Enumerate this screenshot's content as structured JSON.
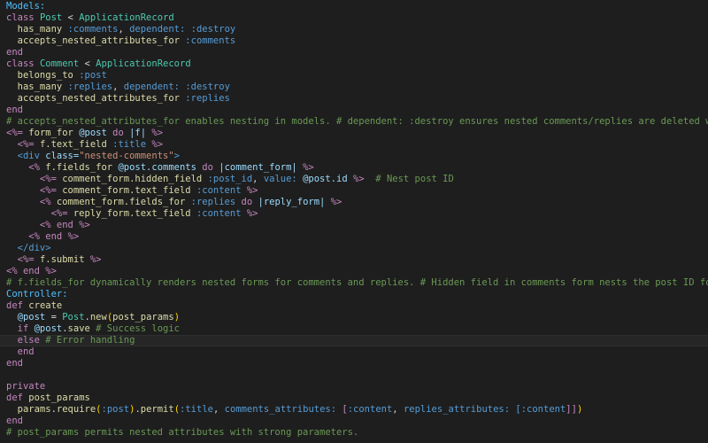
{
  "editor": {
    "theme_colors": {
      "background": "#1e1e1e",
      "text": "#d4d4d4",
      "keyword": "#c586c0",
      "class": "#4ec9b0",
      "method": "#dcdcaa",
      "symbol": "#569cd6",
      "comment": "#6a9955",
      "string": "#ce9178",
      "variable": "#9cdcfe"
    },
    "cursor_line": 29,
    "lines": [
      [
        {
          "t": "Models:",
          "c": "label"
        }
      ],
      [
        {
          "t": "class ",
          "c": "keyword"
        },
        {
          "t": "Post",
          "c": "class"
        },
        {
          "t": " < ",
          "c": "text"
        },
        {
          "t": "ApplicationRecord",
          "c": "class"
        }
      ],
      [
        {
          "t": "  has_many ",
          "c": "method"
        },
        {
          "t": ":comments",
          "c": "symbol"
        },
        {
          "t": ", ",
          "c": "text"
        },
        {
          "t": "dependent: ",
          "c": "symbol"
        },
        {
          "t": ":destroy",
          "c": "symbol"
        }
      ],
      [
        {
          "t": "  accepts_nested_attributes_for ",
          "c": "method"
        },
        {
          "t": ":comments",
          "c": "symbol"
        }
      ],
      [
        {
          "t": "end",
          "c": "keyword"
        }
      ],
      [
        {
          "t": "class ",
          "c": "keyword"
        },
        {
          "t": "Comment",
          "c": "class"
        },
        {
          "t": " < ",
          "c": "text"
        },
        {
          "t": "ApplicationRecord",
          "c": "class"
        }
      ],
      [
        {
          "t": "  belongs_to ",
          "c": "method"
        },
        {
          "t": ":post",
          "c": "symbol"
        }
      ],
      [
        {
          "t": "  has_many ",
          "c": "method"
        },
        {
          "t": ":replies",
          "c": "symbol"
        },
        {
          "t": ", ",
          "c": "text"
        },
        {
          "t": "dependent: ",
          "c": "symbol"
        },
        {
          "t": ":destroy",
          "c": "symbol"
        }
      ],
      [
        {
          "t": "  accepts_nested_attributes_for ",
          "c": "method"
        },
        {
          "t": ":replies",
          "c": "symbol"
        }
      ],
      [
        {
          "t": "end",
          "c": "keyword"
        }
      ],
      [
        {
          "t": "# accepts_nested_attributes_for enables nesting in models. # dependent: :destroy ensures nested comments/replies are deleted with the parent.",
          "c": "comment"
        }
      ],
      [
        {
          "t": "<%= ",
          "c": "erb"
        },
        {
          "t": "form_for ",
          "c": "method"
        },
        {
          "t": "@post ",
          "c": "variable"
        },
        {
          "t": "do ",
          "c": "keyword"
        },
        {
          "t": "|f| ",
          "c": "variable"
        },
        {
          "t": "%>",
          "c": "erb"
        }
      ],
      [
        {
          "t": "  <%= ",
          "c": "erb"
        },
        {
          "t": "f.text_field ",
          "c": "method"
        },
        {
          "t": ":title ",
          "c": "symbol"
        },
        {
          "t": "%>",
          "c": "erb"
        }
      ],
      [
        {
          "t": "  <div ",
          "c": "tag"
        },
        {
          "t": "class=",
          "c": "attr"
        },
        {
          "t": "\"nested-comments\"",
          "c": "string"
        },
        {
          "t": ">",
          "c": "tag"
        }
      ],
      [
        {
          "t": "    <% ",
          "c": "erb"
        },
        {
          "t": "f.fields_for ",
          "c": "method"
        },
        {
          "t": "@post.comments ",
          "c": "variable"
        },
        {
          "t": "do ",
          "c": "keyword"
        },
        {
          "t": "|comment_form| ",
          "c": "variable"
        },
        {
          "t": "%>",
          "c": "erb"
        }
      ],
      [
        {
          "t": "      <%= ",
          "c": "erb"
        },
        {
          "t": "comment_form.hidden_field ",
          "c": "method"
        },
        {
          "t": ":post_id",
          "c": "symbol"
        },
        {
          "t": ", ",
          "c": "text"
        },
        {
          "t": "value: ",
          "c": "symbol"
        },
        {
          "t": "@post.id ",
          "c": "variable"
        },
        {
          "t": "%>  ",
          "c": "erb"
        },
        {
          "t": "# Nest post ID",
          "c": "comment"
        }
      ],
      [
        {
          "t": "      <%= ",
          "c": "erb"
        },
        {
          "t": "comment_form.text_field ",
          "c": "method"
        },
        {
          "t": ":content ",
          "c": "symbol"
        },
        {
          "t": "%>",
          "c": "erb"
        }
      ],
      [
        {
          "t": "      <% ",
          "c": "erb"
        },
        {
          "t": "comment_form.fields_for ",
          "c": "method"
        },
        {
          "t": ":replies ",
          "c": "symbol"
        },
        {
          "t": "do ",
          "c": "keyword"
        },
        {
          "t": "|reply_form| ",
          "c": "variable"
        },
        {
          "t": "%>",
          "c": "erb"
        }
      ],
      [
        {
          "t": "        <%= ",
          "c": "erb"
        },
        {
          "t": "reply_form.text_field ",
          "c": "method"
        },
        {
          "t": ":content ",
          "c": "symbol"
        },
        {
          "t": "%>",
          "c": "erb"
        }
      ],
      [
        {
          "t": "      <% ",
          "c": "erb"
        },
        {
          "t": "end ",
          "c": "keyword"
        },
        {
          "t": "%>",
          "c": "erb"
        }
      ],
      [
        {
          "t": "    <% ",
          "c": "erb"
        },
        {
          "t": "end ",
          "c": "keyword"
        },
        {
          "t": "%>",
          "c": "erb"
        }
      ],
      [
        {
          "t": "  </div>",
          "c": "tag"
        }
      ],
      [
        {
          "t": "  <%= ",
          "c": "erb"
        },
        {
          "t": "f.submit ",
          "c": "method"
        },
        {
          "t": "%>",
          "c": "erb"
        }
      ],
      [
        {
          "t": "<% ",
          "c": "erb"
        },
        {
          "t": "end ",
          "c": "keyword"
        },
        {
          "t": "%>",
          "c": "erb"
        }
      ],
      [
        {
          "t": "# f.fields_for dynamically renders nested forms for comments and replies. # Hidden field in comments form nests the post ID for association.",
          "c": "comment"
        }
      ],
      [
        {
          "t": "Controller:",
          "c": "label"
        }
      ],
      [
        {
          "t": "def ",
          "c": "keyword"
        },
        {
          "t": "create",
          "c": "method"
        }
      ],
      [
        {
          "t": "  @post",
          "c": "variable"
        },
        {
          "t": " = ",
          "c": "text"
        },
        {
          "t": "Post",
          "c": "class"
        },
        {
          "t": ".",
          "c": "text"
        },
        {
          "t": "new",
          "c": "method"
        },
        {
          "t": "(",
          "c": "bracket"
        },
        {
          "t": "post_params",
          "c": "method"
        },
        {
          "t": ")",
          "c": "bracket"
        }
      ],
      [
        {
          "t": "  if ",
          "c": "keyword"
        },
        {
          "t": "@post",
          "c": "variable"
        },
        {
          "t": ".",
          "c": "text"
        },
        {
          "t": "save ",
          "c": "method"
        },
        {
          "t": "# Success logic",
          "c": "comment"
        }
      ],
      [
        {
          "t": "  else ",
          "c": "keyword"
        },
        {
          "t": "# Error handling",
          "c": "comment"
        }
      ],
      [
        {
          "t": "  end",
          "c": "keyword"
        }
      ],
      [
        {
          "t": "end",
          "c": "keyword"
        }
      ],
      [
        {
          "t": "",
          "c": "text"
        }
      ],
      [
        {
          "t": "private",
          "c": "keyword"
        }
      ],
      [
        {
          "t": "def ",
          "c": "keyword"
        },
        {
          "t": "post_params",
          "c": "method"
        }
      ],
      [
        {
          "t": "  params",
          "c": "method"
        },
        {
          "t": ".",
          "c": "text"
        },
        {
          "t": "require",
          "c": "method"
        },
        {
          "t": "(",
          "c": "bracket"
        },
        {
          "t": ":post",
          "c": "symbol"
        },
        {
          "t": ")",
          "c": "bracket"
        },
        {
          "t": ".",
          "c": "text"
        },
        {
          "t": "permit",
          "c": "method"
        },
        {
          "t": "(",
          "c": "bracket"
        },
        {
          "t": ":title",
          "c": "symbol"
        },
        {
          "t": ", ",
          "c": "text"
        },
        {
          "t": "comments_attributes: ",
          "c": "symbol"
        },
        {
          "t": "[",
          "c": "keyword"
        },
        {
          "t": ":content",
          "c": "symbol"
        },
        {
          "t": ", ",
          "c": "text"
        },
        {
          "t": "replies_attributes: ",
          "c": "symbol"
        },
        {
          "t": "[",
          "c": "symbol"
        },
        {
          "t": ":content",
          "c": "symbol"
        },
        {
          "t": "]]",
          "c": "keyword"
        },
        {
          "t": ")",
          "c": "bracket"
        }
      ],
      [
        {
          "t": "end",
          "c": "keyword"
        }
      ],
      [
        {
          "t": "# post_params permits nested attributes with strong parameters.",
          "c": "comment"
        }
      ]
    ]
  }
}
